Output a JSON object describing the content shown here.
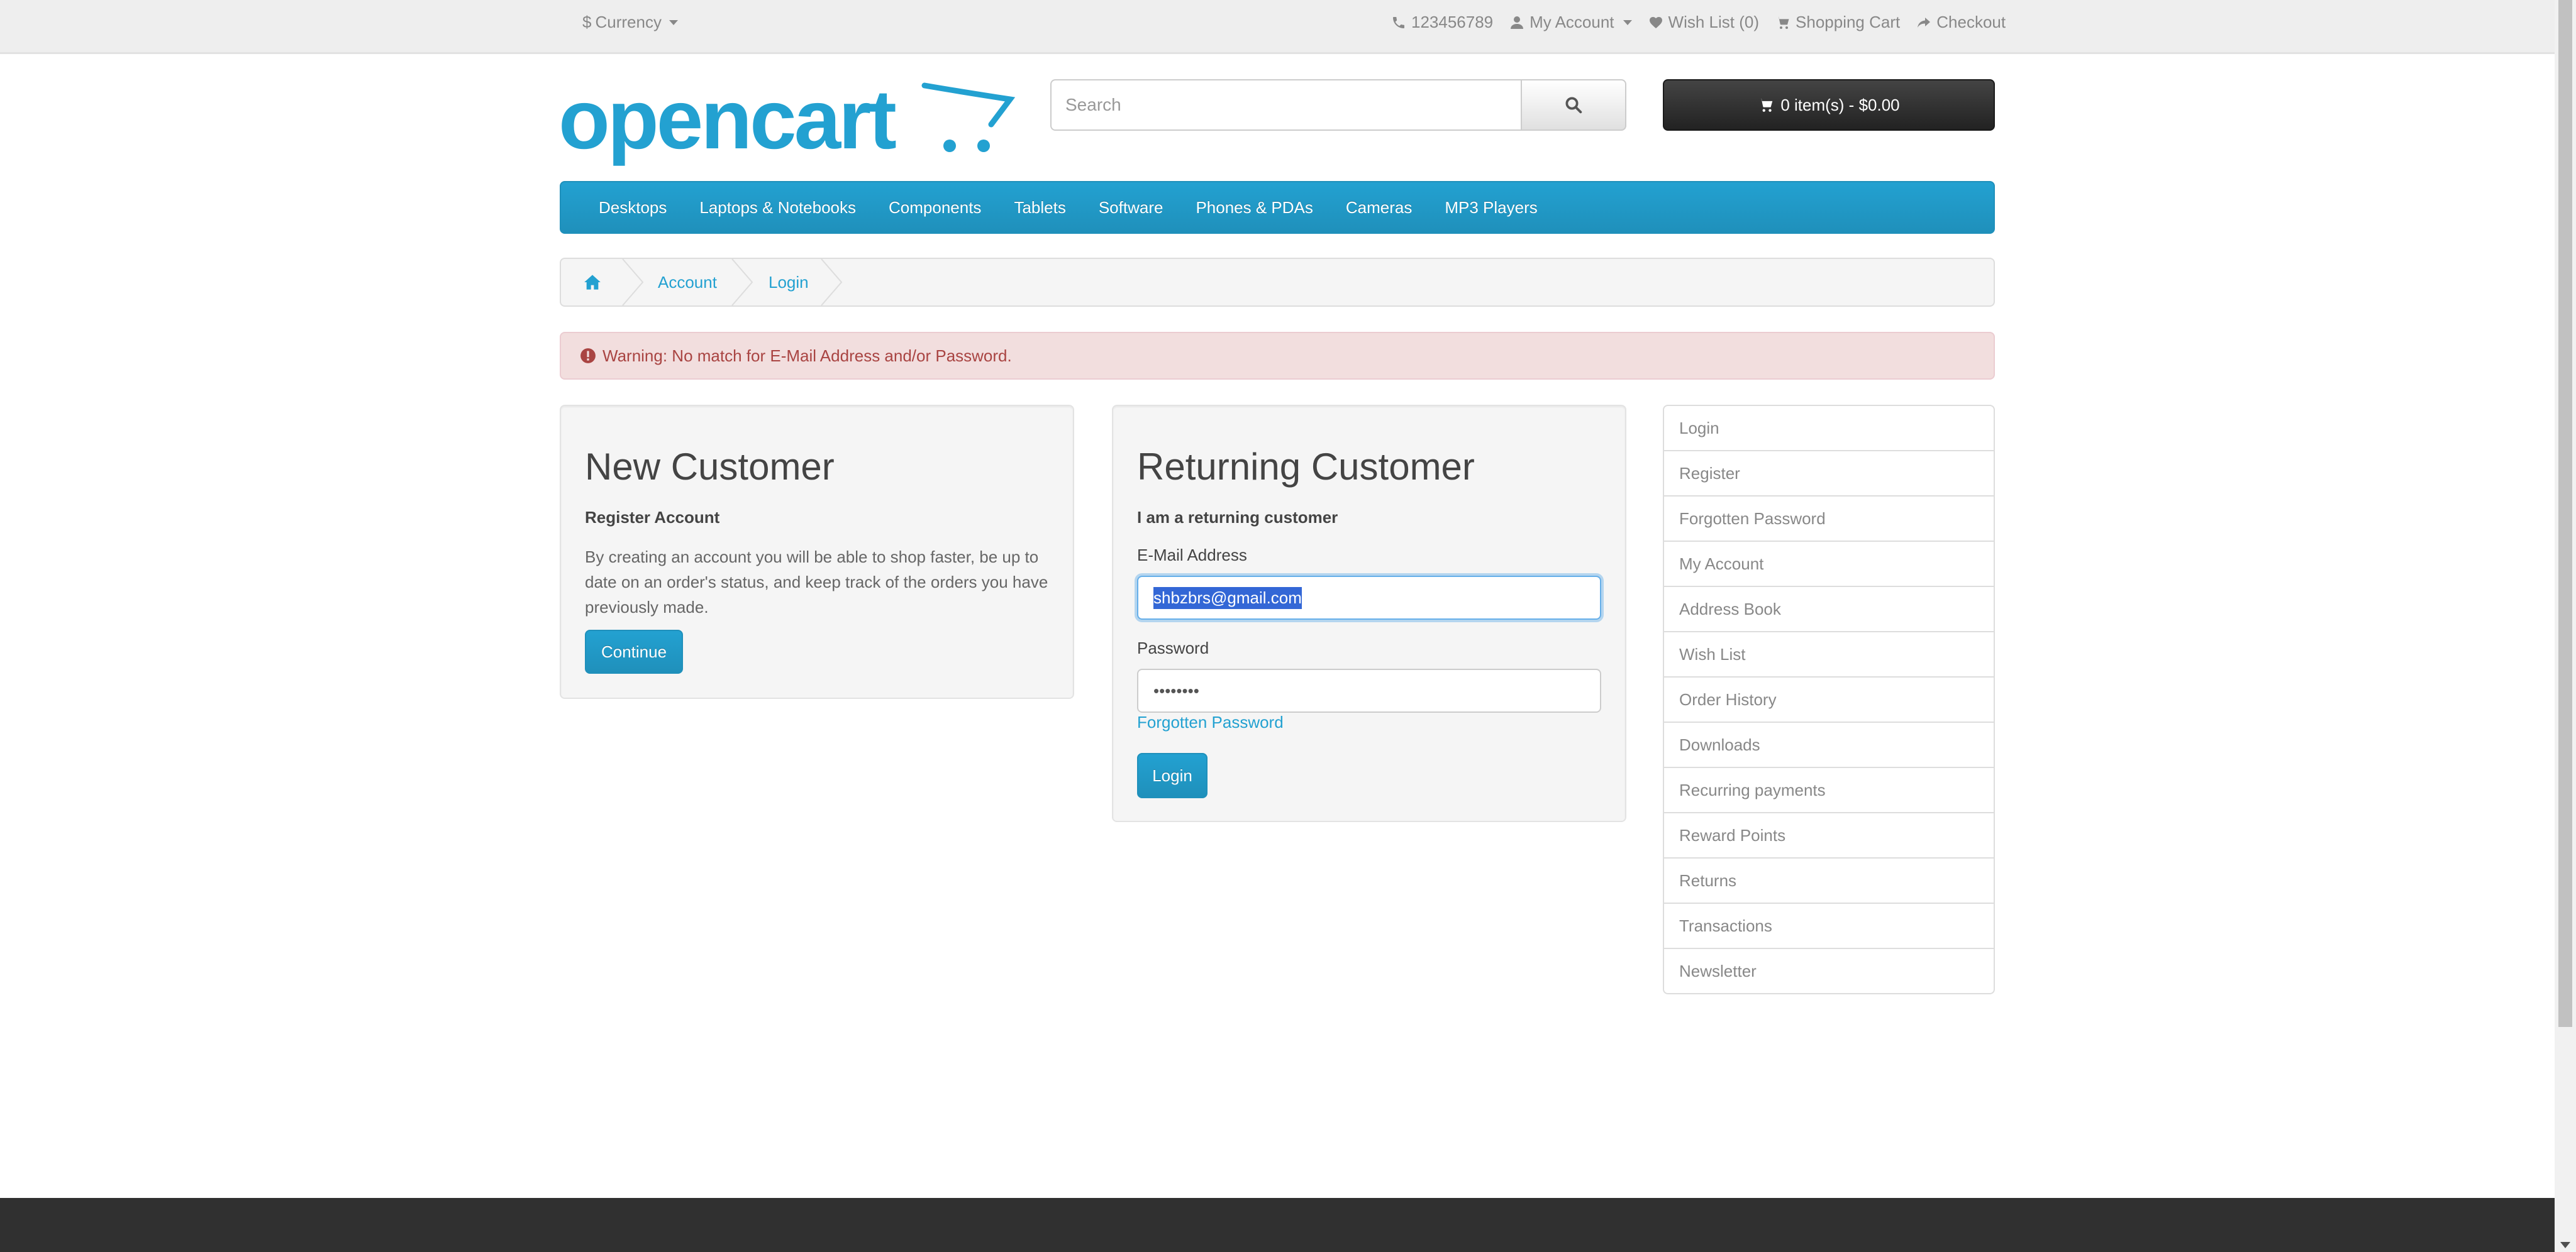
{
  "topbar": {
    "currency_symbol": "$",
    "currency_label": "Currency",
    "phone": "123456789",
    "my_account": "My Account",
    "wish_list": "Wish List (0)",
    "shopping_cart": "Shopping Cart",
    "checkout": "Checkout"
  },
  "header": {
    "logo_text": "opencart",
    "search_placeholder": "Search",
    "cart_summary": "0 item(s) - $0.00"
  },
  "menu": {
    "items": [
      "Desktops",
      "Laptops & Notebooks",
      "Components",
      "Tablets",
      "Software",
      "Phones & PDAs",
      "Cameras",
      "MP3 Players"
    ]
  },
  "breadcrumb": {
    "items": [
      "Account",
      "Login"
    ]
  },
  "alert": {
    "message": "Warning: No match for E-Mail Address and/or Password."
  },
  "new_customer": {
    "title": "New Customer",
    "subtitle": "Register Account",
    "description": "By creating an account you will be able to shop faster, be up to date on an order's status, and keep track of the orders you have previously made.",
    "continue_label": "Continue"
  },
  "returning_customer": {
    "title": "Returning Customer",
    "subtitle": "I am a returning customer",
    "email_label": "E-Mail Address",
    "email_value": "shbzbrs@gmail.com",
    "password_label": "Password",
    "password_value": "••••••••",
    "forgotten_link": "Forgotten Password",
    "login_label": "Login"
  },
  "account_menu": {
    "items": [
      "Login",
      "Register",
      "Forgotten Password",
      "My Account",
      "Address Book",
      "Wish List",
      "Order History",
      "Downloads",
      "Recurring payments",
      "Reward Points",
      "Returns",
      "Transactions",
      "Newsletter"
    ]
  },
  "colors": {
    "accent": "#23a1d1",
    "alert_bg": "#f2dede",
    "alert_text": "#a94442",
    "cart_button": "#333333",
    "footer": "#303030"
  }
}
